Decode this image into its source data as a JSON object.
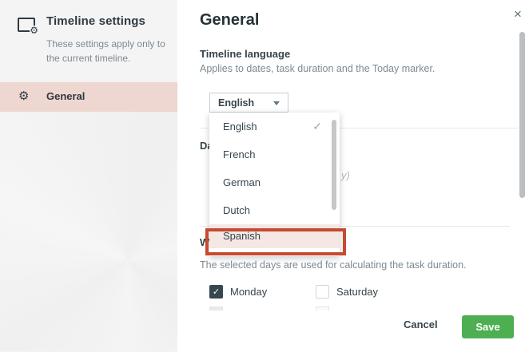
{
  "window": {
    "close_icon": "×"
  },
  "colors": {
    "selected_pink": "#eed6d1",
    "annotation_red": "#c64a31",
    "save_green": "#4daf51",
    "checkbox_dark": "#36474f",
    "text_dark": "#36454c",
    "text_gray": "#7e8a92"
  },
  "sidebar": {
    "title": "Timeline settings",
    "description": "These settings apply only to the current timeline.",
    "items": [
      {
        "label": "General",
        "selected": true
      }
    ]
  },
  "main": {
    "title": "General",
    "language_section": {
      "heading": "Timeline language",
      "description": "Applies to dates, task duration and the Today marker.",
      "select_value": "English"
    },
    "partials": {
      "date_heading": "Da",
      "date_preview": "y)",
      "working_heading": "Wo"
    },
    "working_section": {
      "description": "The selected days are used for calculating the task duration.",
      "checkboxes": [
        {
          "label": "Monday",
          "checked": true
        },
        {
          "label": "Saturday",
          "checked": false
        }
      ]
    },
    "footer": {
      "cancel_label": "Cancel",
      "save_label": "Save"
    }
  },
  "dropdown": {
    "checkmark": "✓",
    "options": [
      {
        "label": "English",
        "selected": true
      },
      {
        "label": "French",
        "selected": false
      },
      {
        "label": "German",
        "selected": false
      },
      {
        "label": "Dutch",
        "selected": false
      },
      {
        "label": "Spanish",
        "selected": false,
        "highlighted": true
      }
    ]
  }
}
